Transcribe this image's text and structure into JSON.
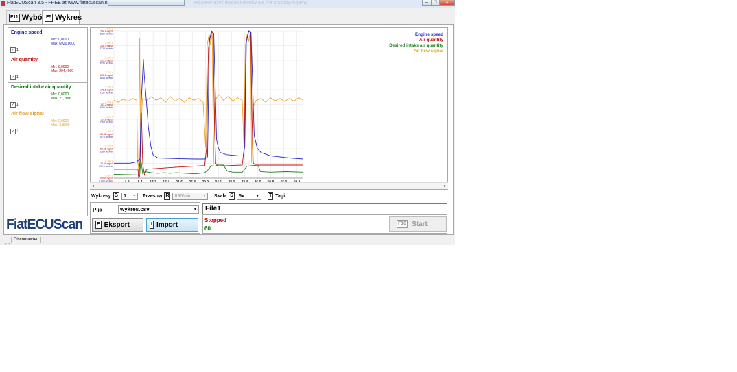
{
  "window": {
    "title": "FiatECUScan 3.5 - FREE at www.fiatecuscan.net",
    "blurred_banner": "Możemy użyć dwóch kolorów ale nie przytrzymujemy",
    "buttons": {
      "minimize": "–",
      "maximize": "□",
      "close": "×"
    }
  },
  "tabs": [
    {
      "key": "F11",
      "label": "Wybór"
    },
    {
      "key": "F5",
      "label": "Wykres"
    }
  ],
  "signals": [
    {
      "name": "Engine speed",
      "color": "#1a1ab0",
      "min": "Min: 0,0000",
      "max": "Max: 6920,0000",
      "checked": "✓",
      "num": "1"
    },
    {
      "name": "Air quantity",
      "color": "#c00000",
      "min": "Min: 0,0000",
      "max": "Max: 294,4000",
      "checked": "✓",
      "num": "1"
    },
    {
      "name": "Desired intake air quantity",
      "color": "#007000",
      "min": "Min: 0,0000",
      "max": "Max: 27,2000",
      "checked": "✓",
      "num": "1"
    },
    {
      "name": "Air flow signal",
      "color": "#e8a020",
      "min": "Min: 0,0000",
      "max": "Max: 3,8800",
      "checked": "✓",
      "num": "1"
    }
  ],
  "logo": "FiatECUScan",
  "chart_data": {
    "type": "line",
    "x_ticks": [
      "4,2",
      "8,4",
      "13,3",
      "17,4",
      "21,6",
      "25,8",
      "29,9",
      "34,1",
      "38,3",
      "42,4",
      "46,6",
      "50,8",
      "55,0",
      "59,2"
    ],
    "x_range": [
      0,
      60.5
    ],
    "legend": [
      "Engine speed",
      "Air quantity",
      "Desired intake air quantity",
      "Air flow signal"
    ],
    "legend_position": "top-right",
    "y_axis_labels": [
      {
        "color": "#e8a020",
        "labels": [
          "0,000 V",
          "0,388 V",
          "0,776 V",
          "1,164 V",
          "1,552 V",
          "1,940 V",
          "2,328 V",
          "2,716 V",
          "3,104 V",
          "3,492 V",
          "3,880 V"
        ]
      },
      {
        "color": "#c00000",
        "labels": [
          "0,000 mg/str",
          "29,44 mg/str",
          "58,88 mg/str",
          "88,32 mg/str",
          "117,8 mg/str",
          "147,2 mg/str",
          "176,6 mg/str",
          "206,1 mg/str",
          "235,5 mg/str",
          "265,0 mg/str",
          "294,4 mg/str"
        ]
      },
      {
        "color": "#1a1ab0",
        "labels": [
          "0,000 obr/min",
          "692,0 obr/min",
          "1384 obr/min",
          "2076 obr/min",
          "2768 obr/min",
          "3460 obr/min",
          "4152 obr/min",
          "4844 obr/min",
          "5536 obr/min",
          "6228 obr/min",
          "6920 obr/min"
        ]
      }
    ],
    "series": [
      {
        "name": "Engine speed",
        "color": "#2828c8",
        "ymax": 6920,
        "points": [
          [
            0,
            700
          ],
          [
            5,
            700
          ],
          [
            6,
            720
          ],
          [
            7.2,
            760
          ],
          [
            8.3,
            900
          ],
          [
            8.7,
            3500
          ],
          [
            9.4,
            5600
          ],
          [
            9.7,
            4800
          ],
          [
            10.4,
            3600
          ],
          [
            11,
            2400
          ],
          [
            11.8,
            1500
          ],
          [
            12.5,
            1100
          ],
          [
            14,
            950
          ],
          [
            20,
            920
          ],
          [
            26,
            900
          ],
          [
            29,
            900
          ],
          [
            29.9,
            1000
          ],
          [
            30.5,
            6500
          ],
          [
            31.3,
            6900
          ],
          [
            31.9,
            6800
          ],
          [
            32.3,
            4500
          ],
          [
            32.8,
            1800
          ],
          [
            33.4,
            1400
          ],
          [
            34,
            1200
          ],
          [
            36,
            1100
          ],
          [
            40,
            1050
          ],
          [
            41.3,
            1050
          ],
          [
            41.8,
            1500
          ],
          [
            42.3,
            6400
          ],
          [
            43.1,
            6920
          ],
          [
            43.8,
            6850
          ],
          [
            44.2,
            5000
          ],
          [
            44.8,
            2000
          ],
          [
            45.8,
            1400
          ],
          [
            47,
            1200
          ],
          [
            50,
            1050
          ],
          [
            56,
            950
          ],
          [
            60.5,
            900
          ]
        ]
      },
      {
        "name": "Air quantity",
        "color": "#c01010",
        "ymax": 294.4,
        "points": [
          [
            0,
            18
          ],
          [
            7.7,
            18
          ],
          [
            7.9,
            0
          ],
          [
            8.4,
            40
          ],
          [
            8.8,
            130
          ],
          [
            9.2,
            28
          ],
          [
            9.8,
            5
          ],
          [
            10.4,
            18
          ],
          [
            20,
            22
          ],
          [
            29,
            25
          ],
          [
            29.6,
            60
          ],
          [
            30.2,
            260
          ],
          [
            31.1,
            294
          ],
          [
            31.7,
            290
          ],
          [
            32.1,
            120
          ],
          [
            32.5,
            30
          ],
          [
            33.2,
            24
          ],
          [
            41,
            26
          ],
          [
            41.6,
            60
          ],
          [
            42.2,
            270
          ],
          [
            43.0,
            294
          ],
          [
            43.7,
            292
          ],
          [
            44.1,
            120
          ],
          [
            44.5,
            30
          ],
          [
            45.2,
            26
          ],
          [
            60.5,
            26
          ]
        ]
      },
      {
        "name": "Desired intake air quantity",
        "color": "#208020",
        "ymax": 27.2,
        "points": [
          [
            0,
            0.7
          ],
          [
            7.5,
            0.6
          ],
          [
            8.2,
            0.3
          ],
          [
            8.6,
            3.5
          ],
          [
            9.2,
            0.8
          ],
          [
            10,
            1.2
          ],
          [
            12,
            1.0
          ],
          [
            14,
            0.9
          ],
          [
            16,
            1.0
          ],
          [
            18,
            0.9
          ],
          [
            20,
            1.0
          ],
          [
            23,
            0.9
          ],
          [
            26,
            0.8
          ],
          [
            29,
            1.0
          ],
          [
            30.5,
            1.8
          ],
          [
            31,
            2.3
          ],
          [
            32.5,
            2.2
          ],
          [
            33,
            2.4
          ],
          [
            35,
            2.4
          ],
          [
            36.2,
            1.3
          ],
          [
            38,
            1.1
          ],
          [
            41,
            1.1
          ],
          [
            42.5,
            2.2
          ],
          [
            46,
            2.4
          ],
          [
            46.8,
            1.2
          ],
          [
            50,
            1.1
          ],
          [
            55,
            1.2
          ],
          [
            60.5,
            1.1
          ]
        ]
      },
      {
        "name": "Air flow signal",
        "color": "#f0a028",
        "ymax": 3.88,
        "points": [
          [
            0,
            2.05
          ],
          [
            1.5,
            2.0
          ],
          [
            3,
            2.08
          ],
          [
            4.5,
            2.02
          ],
          [
            6,
            2.1
          ],
          [
            7.3,
            2.05
          ],
          [
            7.6,
            0.4
          ],
          [
            7.9,
            0.25
          ],
          [
            8.2,
            3.7
          ],
          [
            8.5,
            1.0
          ],
          [
            9.1,
            2.1
          ],
          [
            10.5,
            2.05
          ],
          [
            12,
            2.15
          ],
          [
            13.5,
            2.05
          ],
          [
            15,
            2.12
          ],
          [
            16.5,
            2.0
          ],
          [
            18,
            2.15
          ],
          [
            19.5,
            2.03
          ],
          [
            21,
            2.1
          ],
          [
            22.5,
            2.0
          ],
          [
            24,
            2.12
          ],
          [
            25.5,
            2.05
          ],
          [
            27,
            2.1
          ],
          [
            28.5,
            2.0
          ],
          [
            29.3,
            0.8
          ],
          [
            29.8,
            3.5
          ],
          [
            30.4,
            3.8
          ],
          [
            30.9,
            3.5
          ],
          [
            31.4,
            3.88
          ],
          [
            31.8,
            0.35
          ],
          [
            32.3,
            2.05
          ],
          [
            33.5,
            2.2
          ],
          [
            35,
            2.05
          ],
          [
            36.5,
            2.15
          ],
          [
            38,
            2.03
          ],
          [
            39.5,
            2.12
          ],
          [
            41,
            2.05
          ],
          [
            41.5,
            0.9
          ],
          [
            42,
            3.5
          ],
          [
            42.6,
            3.8
          ],
          [
            43.1,
            3.6
          ],
          [
            43.6,
            3.88
          ],
          [
            44,
            0.4
          ],
          [
            44.5,
            1.9
          ],
          [
            45.5,
            2.05
          ],
          [
            47,
            2.1
          ],
          [
            48.5,
            2.0
          ],
          [
            50,
            2.12
          ],
          [
            51.5,
            2.04
          ],
          [
            53,
            2.1
          ],
          [
            54.5,
            2.02
          ],
          [
            56,
            2.1
          ],
          [
            57.5,
            2.03
          ],
          [
            59,
            2.12
          ],
          [
            60.5,
            2.05
          ]
        ]
      }
    ]
  },
  "controls": {
    "wykresy_label": "Wykresy",
    "wykresy_key": "G",
    "wykresy_value": "1",
    "przesuw_label": "Przesuw",
    "przesuw_key": "R",
    "przesuw_value": "896/min",
    "skala_label": "Skala",
    "skala_key": "S",
    "skala_value": "5x",
    "tagi_key": "T",
    "tagi_label": "Tagi"
  },
  "file": {
    "plik_label": "Plik",
    "plik_value": "wykres.csv",
    "eksport_key": "E",
    "eksport_label": "Eksport",
    "import_key": "I",
    "import_label": "Import"
  },
  "session": {
    "name": "File1",
    "status": "Stopped",
    "count": "60",
    "start_key": "F10",
    "start_label": "Start"
  },
  "statusbar": {
    "text": "Disconnected"
  }
}
